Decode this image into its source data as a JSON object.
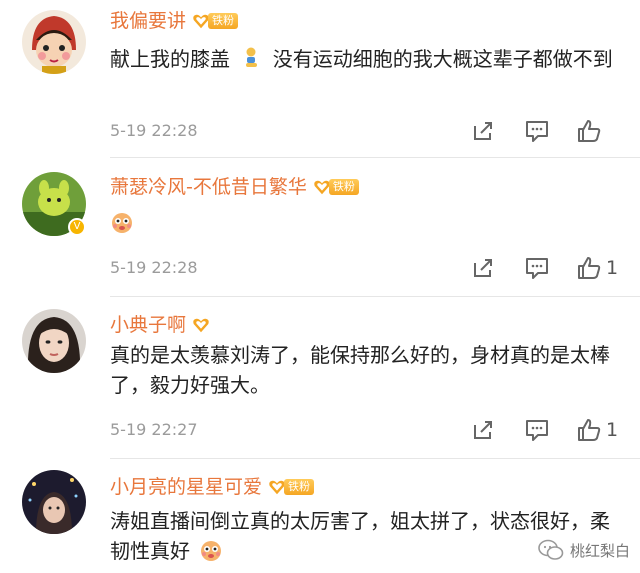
{
  "comments": [
    {
      "username": "我偏要讲",
      "badge": "铁粉",
      "text_before": "献上我的膝盖",
      "text_after": "没有运动细胞的我大概这辈子都做不到",
      "time": "5-19 22:28",
      "likes": "",
      "avatar": "baby-doll-avatar"
    },
    {
      "username": "萧瑟冷风-不低昔日繁华",
      "badge": "铁粉",
      "text_before": "",
      "text_after": "",
      "time": "5-19 22:28",
      "likes": "1",
      "avatar": "green-creature-avatar",
      "verified": "V"
    },
    {
      "username": "小典子啊",
      "badge": "",
      "text_before": "真的是太羡慕刘涛了，能保持那么好的，身材真的是太棒了，毅力好强大。",
      "text_after": "",
      "time": "5-19 22:27",
      "likes": "1",
      "avatar": "girl-photo-avatar"
    },
    {
      "username": "小月亮的星星可爱",
      "badge": "铁粉",
      "text_before": "涛姐直播间倒立真的太厉害了，姐太拼了，状态很好，柔韧性真好",
      "text_after": "",
      "time": "",
      "likes": "",
      "avatar": "night-photo-avatar"
    }
  ],
  "watermark": "桃红梨白",
  "colors": {
    "username": "#e8773c",
    "time": "#9b9b9b",
    "badge": "#f5a623"
  }
}
